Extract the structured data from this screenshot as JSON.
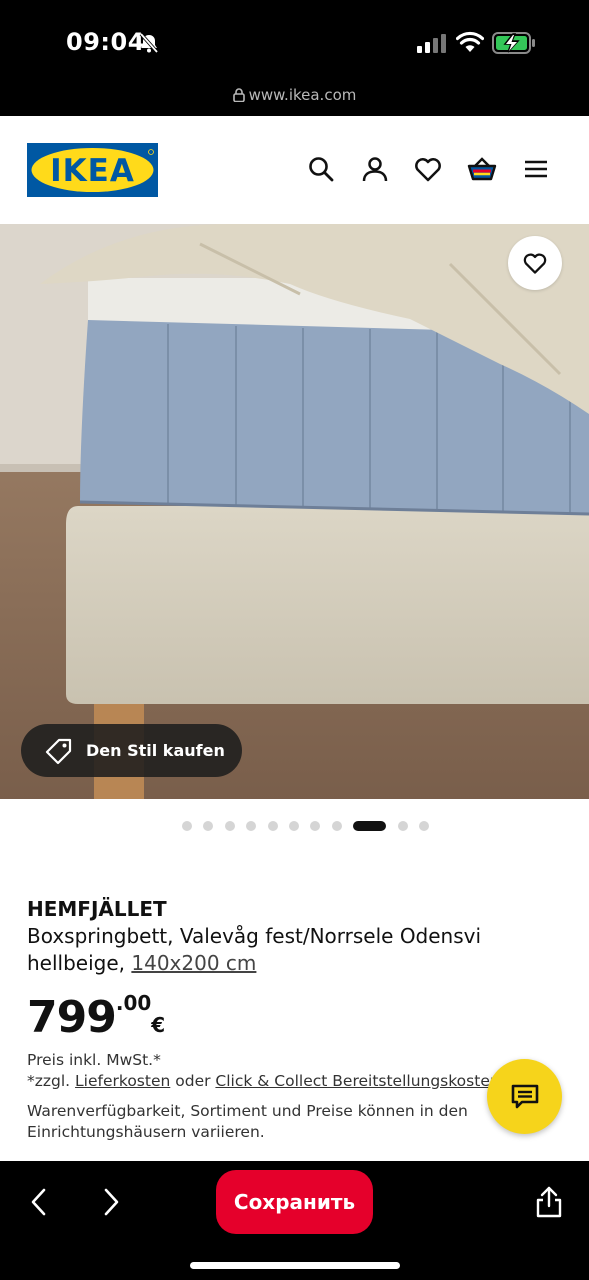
{
  "status_bar": {
    "time": "09:04",
    "url": "www.ikea.com",
    "icons": [
      "bell-slash-icon",
      "signal-icon",
      "wifi-icon",
      "battery-charging-icon"
    ]
  },
  "header": {
    "logo_text": "IKEA",
    "icons": [
      "search-icon",
      "user-icon",
      "heart-icon",
      "cart-icon",
      "menu-icon"
    ],
    "colors": {
      "logo_blue": "#0058a3",
      "logo_yellow": "#ffda1a"
    }
  },
  "hero": {
    "shop_style_label": "Den Stil kaufen",
    "carousel": {
      "total": 11,
      "active": 9
    }
  },
  "product": {
    "name": "HEMFJÄLLET",
    "description": "Boxspringbett, Valevåg fest/Norrsele Odensvi hellbeige,",
    "size": "140x200 cm",
    "price_int": "799",
    "price_dec": ".00",
    "currency": "€",
    "tax_note": "Preis inkl. MwSt.*",
    "ship_prefix": "*zzgl.",
    "ship_link1": "Lieferkosten",
    "ship_mid": "oder",
    "ship_link2": "Click & Collect Bereitstellungskosten",
    "availability": "Warenverfügbarkeit, Sortiment und Preise können in den Einrichtungshäusern variieren."
  },
  "toolbar": {
    "save_label": "Сохранить",
    "colors": {
      "save_bg": "#e5002b",
      "chat_bg": "#f6d41b"
    }
  }
}
